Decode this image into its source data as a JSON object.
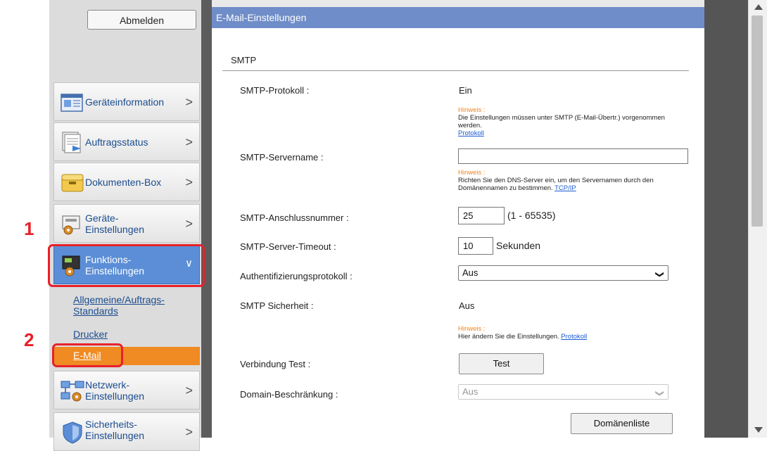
{
  "sidebar": {
    "logout_label": "Abmelden",
    "items": [
      {
        "label": "Geräteinformation",
        "icon": "device-info-icon"
      },
      {
        "label": "Auftragsstatus",
        "icon": "job-status-icon"
      },
      {
        "label": "Dokumenten-Box",
        "icon": "document-box-icon"
      },
      {
        "label": "Geräte-\nEinstellungen",
        "icon": "device-settings-icon"
      },
      {
        "label": "Funktions-\nEinstellungen",
        "icon": "function-settings-icon"
      },
      {
        "label": "Netzwerk-\nEinstellungen",
        "icon": "network-settings-icon"
      },
      {
        "label": "Sicherheits-\nEinstellungen",
        "icon": "security-settings-icon"
      }
    ],
    "subitems": [
      "Allgemeine/Auftrags-\nStandards",
      "Drucker",
      "E-Mail"
    ],
    "active_color": "#5b8ed6",
    "selected_sub_color": "#f08a22"
  },
  "annotations": {
    "step1": "1",
    "step2": "2",
    "ring_color": "#e8202a"
  },
  "main": {
    "title": "E-Mail-Einstellungen",
    "section": "SMTP",
    "rows": {
      "smtp_protocol": {
        "label": "SMTP-Protokoll :",
        "value": "Ein"
      },
      "hint1": {
        "title": "Hinweis :",
        "text": "Die Einstellungen müssen unter SMTP (E-Mail-Übertr.) vorgenommen werden.",
        "link": "Protokoll"
      },
      "server_name": {
        "label": "SMTP-Servername :",
        "value": ""
      },
      "hint2": {
        "title": "Hinweis :",
        "text": "Richten Sie den DNS-Server ein, um den Servernamen durch den Domänennamen zu bestimmen.",
        "link": "TCP/IP"
      },
      "port": {
        "label": "SMTP-Anschlussnummer :",
        "value": "25",
        "range": "(1 - 65535)"
      },
      "timeout": {
        "label": "SMTP-Server-Timeout :",
        "value": "10",
        "unit": "Sekunden"
      },
      "auth": {
        "label": "Authentifizierungsprotokoll :",
        "value": "Aus"
      },
      "security": {
        "label": "SMTP Sicherheit :",
        "value": "Aus"
      },
      "hint3": {
        "title": "Hinweis :",
        "text": "Hier ändern Sie die Einstellungen.",
        "link": "Protokoll"
      },
      "test": {
        "label": "Verbindung Test :",
        "button": "Test"
      },
      "domain": {
        "label": "Domain-Beschränkung :",
        "value": "Aus"
      },
      "domain_list_button": "Domänenliste"
    },
    "title_bar_color": "#6f8dc8"
  }
}
